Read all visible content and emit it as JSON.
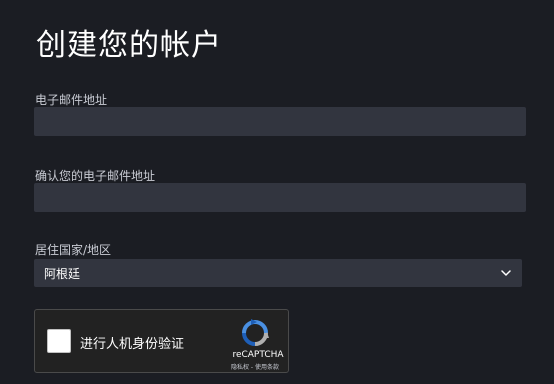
{
  "page": {
    "title": "创建您的帐户"
  },
  "form": {
    "email": {
      "label": "电子邮件地址",
      "value": "",
      "placeholder": ""
    },
    "confirm_email": {
      "label": "确认您的电子邮件地址",
      "value": "",
      "placeholder": ""
    },
    "country": {
      "label": "居住国家/地区",
      "selected": "阿根廷"
    }
  },
  "captcha": {
    "label": "进行人机身份验证",
    "brand": "reCAPTCHA",
    "links": "隐私权 - 使用条款",
    "checked": false
  },
  "colors": {
    "background": "#1b1d23",
    "field_background": "#32353f",
    "label_text": "#c9ccd4",
    "recaptcha_blue": "#4a90e2",
    "recaptcha_gray": "#b0b0b0"
  },
  "icons": {
    "select_chevron": "chevron-down-icon",
    "captcha_logo": "recaptcha-logo-icon"
  }
}
